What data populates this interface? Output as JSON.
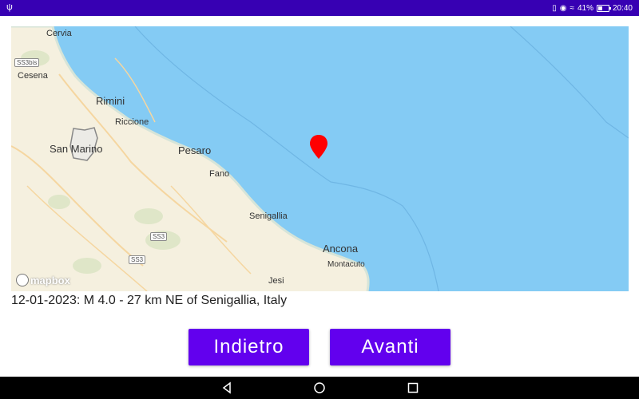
{
  "status_bar": {
    "usb_icon": "usb-icon",
    "battery_percent": "41%",
    "time": "20:40"
  },
  "map": {
    "labels": {
      "cervia": "Cervia",
      "ss3bis": "SS3bis",
      "cesena": "Cesena",
      "rimini": "Rimini",
      "riccione": "Riccione",
      "san_marino": "San Marino",
      "pesaro": "Pesaro",
      "fano": "Fano",
      "senigallia": "Senigallia",
      "ss3_a": "SS3",
      "ss3_b": "SS3",
      "ancona": "Ancona",
      "montacuto": "Montacuto",
      "jesi": "Jesi"
    },
    "attribution": "mapbox",
    "colors": {
      "sea": "#84cbf4",
      "land": "#f5f0df",
      "marker": "#ff0000"
    }
  },
  "event": {
    "description": "12-01-2023: M 4.0 - 27 km NE of Senigallia, Italy"
  },
  "buttons": {
    "back": "Indietro",
    "next": "Avanti"
  }
}
